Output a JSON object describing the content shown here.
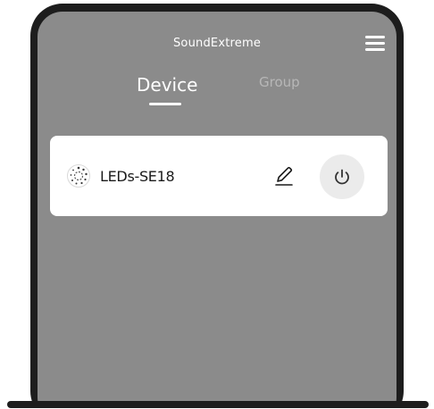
{
  "header": {
    "app_title": "SoundExtreme",
    "menu_icon": "hamburger-menu-icon"
  },
  "tabs": [
    {
      "label": "Device",
      "active": true
    },
    {
      "label": "Group",
      "active": false
    }
  ],
  "devices": [
    {
      "name": "LEDs-SE18",
      "icon": "device-spinner-icon",
      "edit_icon": "pencil-icon",
      "power_icon": "power-icon"
    }
  ],
  "colors": {
    "screen_background": "#8b8b8b",
    "card_background": "#ffffff",
    "frame": "#1d1d1d",
    "inactive_tab": "#b7b7b7",
    "power_button_background": "#ebebeb"
  }
}
